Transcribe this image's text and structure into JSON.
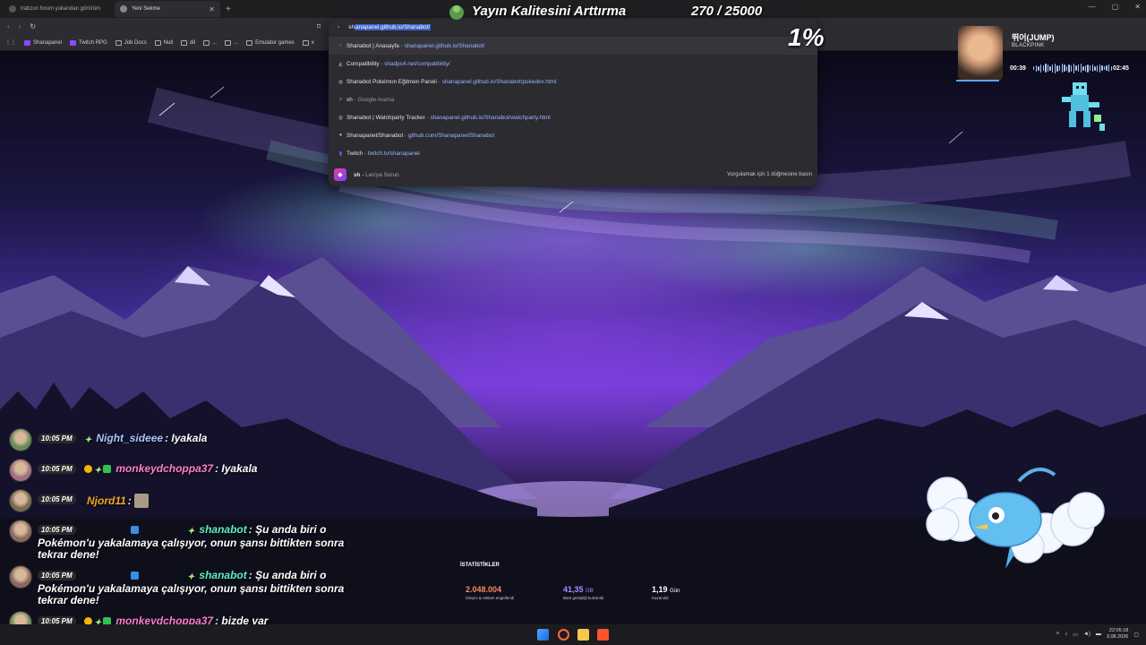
{
  "browser": {
    "tabs": [
      {
        "title": "trabzon forum yukarıdan görürüm",
        "active": false
      },
      {
        "title": "Yeni Sekme",
        "active": true
      }
    ],
    "window_controls": [
      "—",
      "▢",
      "✕"
    ],
    "bookmarks": [
      "Shanapanel",
      "Twitch RPG",
      "Job Docs",
      "Null",
      "dil",
      "...",
      "...",
      "Emulator games",
      "x"
    ]
  },
  "omnibox": {
    "typed": "sh",
    "selected_completion": "anapanel.github.io/Shanabot/",
    "suggestions": [
      {
        "title": "Shanabot | Anasayfa",
        "url": "shanapanel.github.io/Shanabot/",
        "icon": "bookmark-icon"
      },
      {
        "title": "Compatibility",
        "url": "shadps4.net/compatibility/",
        "icon": "site-icon"
      },
      {
        "title": "Shanabot Pokémon Eğitmen Paneli",
        "url": "shanapanel.github.io/Shanabot/pokedex.html",
        "icon": "globe-icon"
      },
      {
        "title": "sh",
        "url": "Google Arama",
        "icon": "search-icon"
      },
      {
        "title": "Shanabot | Watchparty Tracker",
        "url": "shanapanel.github.io/Shanabot/watchparty.html",
        "icon": "globe-icon"
      },
      {
        "title": "Shanapanel/Shanabot",
        "url": "github.com/Shanapanel/Shanabot",
        "icon": "github-icon"
      },
      {
        "title": "Twitch",
        "url": "twitch.tv/shanapanel",
        "icon": "twitch-icon"
      }
    ],
    "leo": {
      "query": "sh",
      "label": "Leo'ya Sorun",
      "hint": "Vurgulamak için 1 düğmesine basın"
    }
  },
  "overlay": {
    "goal_title": "Yayın Kalitesini Arttırma",
    "goal_count": "270 / 25000",
    "goal_percent": "1%"
  },
  "music": {
    "song": "뛰어(JUMP)",
    "artist": "BLACKPINK",
    "elapsed": "00:39",
    "duration": "02:45",
    "progress": 0.24
  },
  "chat": [
    {
      "time": "10:05 PM",
      "badges": [
        "sparkle"
      ],
      "user": "Night_sideee",
      "color": "#a9c4ff",
      "text": ": Iyakala",
      "wrap": false
    },
    {
      "time": "10:05 PM",
      "badges": [
        "coin",
        "sparkle",
        "gift"
      ],
      "user": "monkeydchoppa37",
      "color": "#ff7ecb",
      "text": ": Iyakala",
      "wrap": false
    },
    {
      "time": "10:05 PM",
      "badges": [],
      "user": "Njord11",
      "color": "#f5a623",
      "text": ":",
      "wrap": false,
      "emote": true
    },
    {
      "time": "10:05 PM",
      "badges": [
        "bot",
        "sparkle"
      ],
      "user": "shanabot",
      "color": "#5cf0c2",
      "text": ": Şu anda biri o Pokémon'u yakalamaya çalışıyor, onun şansı bittikten sonra tekrar dene!",
      "wrap": true
    },
    {
      "time": "10:05 PM",
      "badges": [
        "bot",
        "sparkle"
      ],
      "user": "shanabot",
      "color": "#5cf0c2",
      "text": ": Şu anda biri o Pokémon'u yakalamaya çalışıyor, onun şansı bittikten sonra tekrar dene!",
      "wrap": true
    },
    {
      "time": "10:05 PM",
      "badges": [
        "coin",
        "sparkle",
        "gift"
      ],
      "user": "monkeydchoppa37",
      "color": "#ff7ecb",
      "text": ": bizde var",
      "wrap": false
    }
  ],
  "stats": {
    "heading": "İSTATİSTİKLER",
    "items": [
      {
        "value": "2.048.004",
        "unit": "",
        "label": "İzleyici & reklam engellendi",
        "color": "#ff8a5c"
      },
      {
        "value": "41,35",
        "unit": "GB",
        "label": "Bant genişliği kurtarıldı",
        "color": "#a88cff"
      },
      {
        "value": "1,19",
        "unit": "Gün",
        "label": "Kazanıldı",
        "color": "#ffffff"
      }
    ]
  },
  "taskbar": {
    "time": "22:05:18",
    "date": "3.08.2026"
  },
  "colors": {
    "accent": "#3b62c7",
    "chrome_bg": "#2d2d31",
    "omnibox_bg": "#2b2b30"
  }
}
